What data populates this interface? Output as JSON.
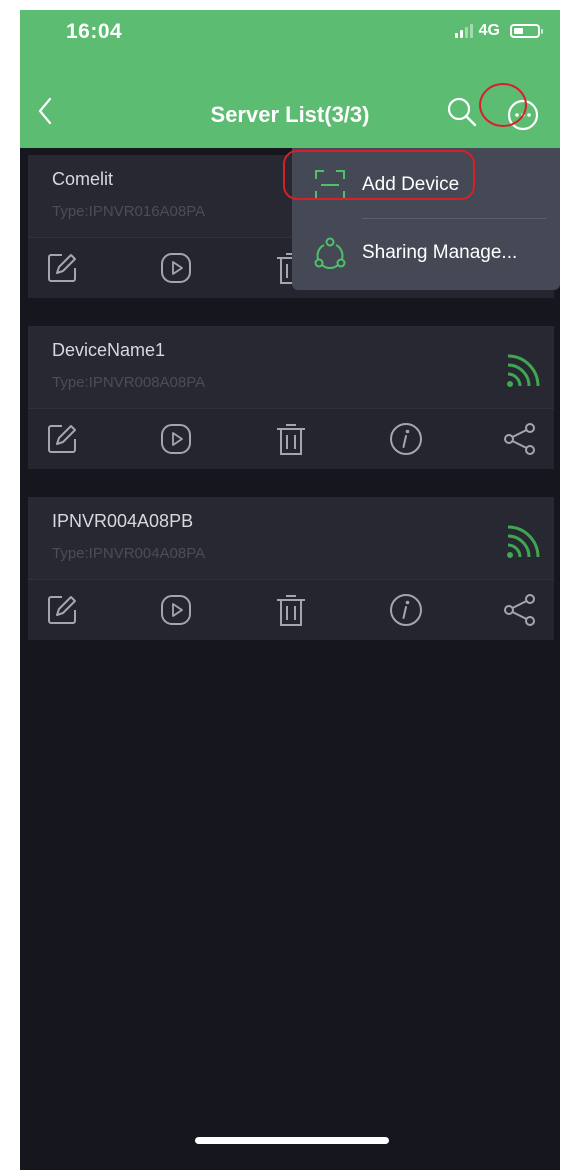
{
  "status": {
    "time": "16:04",
    "network": "4G"
  },
  "header": {
    "title": "Server List(3/3)"
  },
  "menu": {
    "items": [
      {
        "label": "Add Device",
        "icon": "scan-icon"
      },
      {
        "label": "Sharing Manage...",
        "icon": "share-group-icon"
      }
    ]
  },
  "devices": [
    {
      "name": "Comelit",
      "type": "Type:IPNVR016A08PA",
      "online": false
    },
    {
      "name": "DeviceName1",
      "type": "Type:IPNVR008A08PA",
      "online": true
    },
    {
      "name": "IPNVR004A08PB",
      "type": "Type:IPNVR004A08PA",
      "online": true
    }
  ],
  "colors": {
    "accent": "#5cbc72",
    "background": "#16171e",
    "card": "#24252e",
    "menu": "#454855",
    "highlight": "#d7212a"
  }
}
